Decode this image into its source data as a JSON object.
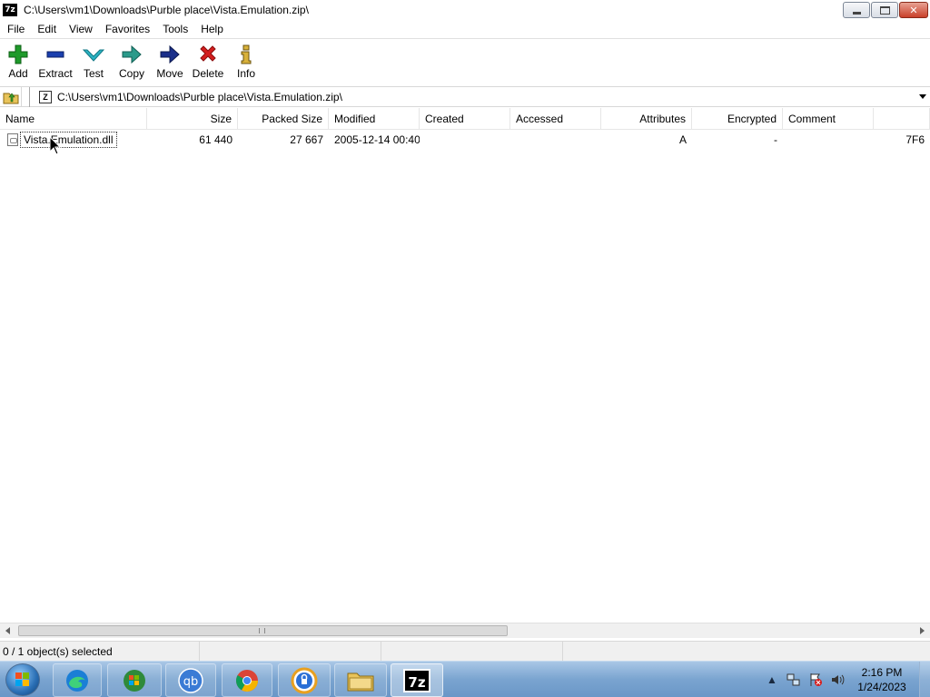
{
  "window": {
    "title": "C:\\Users\\vm1\\Downloads\\Purble place\\Vista.Emulation.zip\\",
    "app_icon_text": "7z"
  },
  "menu": [
    "File",
    "Edit",
    "View",
    "Favorites",
    "Tools",
    "Help"
  ],
  "toolbar": {
    "add": "Add",
    "extract": "Extract",
    "test": "Test",
    "copy": "Copy",
    "move": "Move",
    "delete": "Delete",
    "info": "Info"
  },
  "address": {
    "path": "C:\\Users\\vm1\\Downloads\\Purble place\\Vista.Emulation.zip\\"
  },
  "columns": {
    "name": "Name",
    "size": "Size",
    "packed_size": "Packed Size",
    "modified": "Modified",
    "created": "Created",
    "accessed": "Accessed",
    "attributes": "Attributes",
    "encrypted": "Encrypted",
    "comment": "Comment"
  },
  "rows": [
    {
      "name": "Vista.Emulation.dll",
      "size": "61 440",
      "packed_size": "27 667",
      "modified": "2005-12-14 00:40",
      "created": "",
      "accessed": "",
      "attributes": "A",
      "encrypted": "-",
      "comment": "",
      "crc": "7F6"
    }
  ],
  "status": {
    "selection": "0 / 1 object(s) selected"
  },
  "taskbar": {
    "qb_label": "qb",
    "sevenzip_label": "7z"
  },
  "clock": {
    "time": "2:16 PM",
    "date": "1/24/2023"
  },
  "colors": {
    "add_green": "#1e9a2a",
    "extract_blue": "#1a3fae",
    "test_teal": "#2bb3c2",
    "move_navy": "#1a2f8a",
    "delete_red": "#d41e1e",
    "taskbar": "#7aa4d0"
  }
}
